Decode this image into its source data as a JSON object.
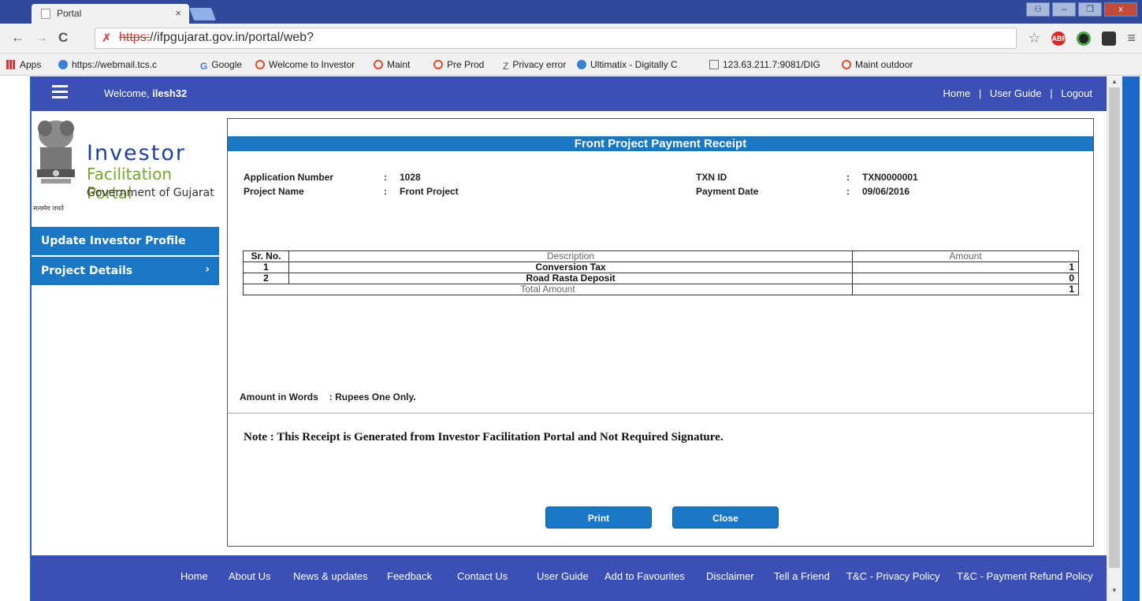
{
  "browser": {
    "tab_title": "Portal",
    "tab_close": "×",
    "window_buttons": [
      "⚇",
      "–",
      "❐",
      "x"
    ],
    "url_protocol": "https:",
    "url_rest": "//ifpgujarat.gov.in/portal/web?",
    "bookmarks": [
      "Apps",
      "https://webmail.tcs.c",
      "Google",
      "Welcome to Investor",
      "Maint",
      "Pre Prod",
      "Privacy error",
      "Ultimatix - Digitally C",
      "123.63.211.7:9081/DIG",
      "Maint outdoor"
    ],
    "extension_labels": [
      "ABP"
    ]
  },
  "header": {
    "welcome_label": "Welcome,",
    "username": "ilesh32",
    "links": [
      "Home",
      "User Guide",
      "Logout"
    ],
    "separator": "|"
  },
  "logo": {
    "line1": "Investor",
    "line2": "Facilitation Portal",
    "line3": "Government of Gujarat",
    "motto": "सत्यमेव जयते"
  },
  "sidebar": {
    "items": [
      {
        "label": "Update Investor Profile"
      },
      {
        "label": "Project Details",
        "chevron": "›"
      }
    ]
  },
  "receipt": {
    "title": "Front Project Payment Receipt",
    "colon": ":",
    "application_number_label": "Application Number",
    "application_number": "1028",
    "project_name_label": "Project Name",
    "project_name": "Front Project",
    "txn_id_label": "TXN ID",
    "txn_id": "TXN0000001",
    "payment_date_label": "Payment Date",
    "payment_date": "09/06/2016",
    "table": {
      "headers": [
        "Sr. No.",
        "Description",
        "Amount"
      ],
      "rows": [
        {
          "sr": "1",
          "description": "Conversion Tax",
          "amount": "1"
        },
        {
          "sr": "2",
          "description": "Road Rasta Deposit",
          "amount": "0"
        }
      ],
      "total_label": "Total Amount",
      "total_amount": "1"
    },
    "amount_words_label": "Amount in Words",
    "amount_words": "Rupees One Only.",
    "note": "Note : This Receipt is Generated from Investor Facilitation Portal and Not Required Signature.",
    "print_label": "Print",
    "close_label": "Close"
  },
  "footer": {
    "links": [
      "Home",
      "About Us",
      "News & updates",
      "Feedback",
      "Contact Us",
      "User Guide",
      "Add to Favourites",
      "Disclaimer",
      "Tell a Friend",
      "T&C - Privacy Policy",
      "T&C - Payment Refund Policy"
    ]
  },
  "colors": {
    "header_blue": "#3c4fb5",
    "accent_blue": "#1a77c4",
    "logo_blue": "#1f3fa0",
    "logo_green": "#7aa52b"
  }
}
